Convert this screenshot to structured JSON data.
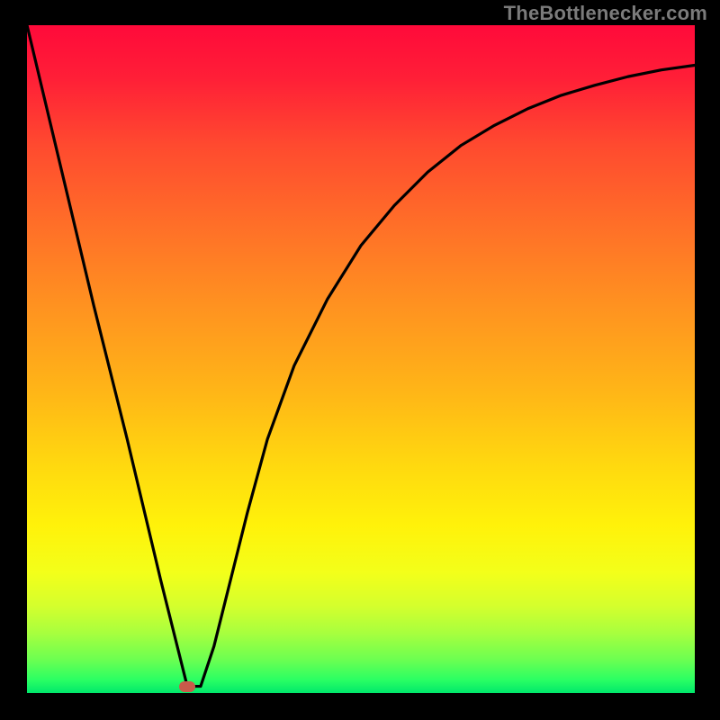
{
  "watermark": "TheBottlenecker.com",
  "chart_data": {
    "type": "line",
    "title": "",
    "xlabel": "",
    "ylabel": "",
    "xlim": [
      0,
      100
    ],
    "ylim": [
      0,
      100
    ],
    "x": [
      0,
      5,
      10,
      15,
      20,
      24,
      26,
      28,
      30,
      33,
      36,
      40,
      45,
      50,
      55,
      60,
      65,
      70,
      75,
      80,
      85,
      90,
      95,
      100
    ],
    "values": [
      100,
      79,
      58,
      38,
      17,
      1,
      1,
      7,
      15,
      27,
      38,
      49,
      59,
      67,
      73,
      78,
      82,
      85,
      87.5,
      89.5,
      91,
      92.3,
      93.3,
      94
    ],
    "marker": {
      "x": 24,
      "y": 1
    },
    "gradient_stops": [
      {
        "pos": 0,
        "color": "#ff0a3a"
      },
      {
        "pos": 0.5,
        "color": "#ffb617"
      },
      {
        "pos": 0.8,
        "color": "#fff20a"
      },
      {
        "pos": 1.0,
        "color": "#00e86b"
      }
    ]
  }
}
